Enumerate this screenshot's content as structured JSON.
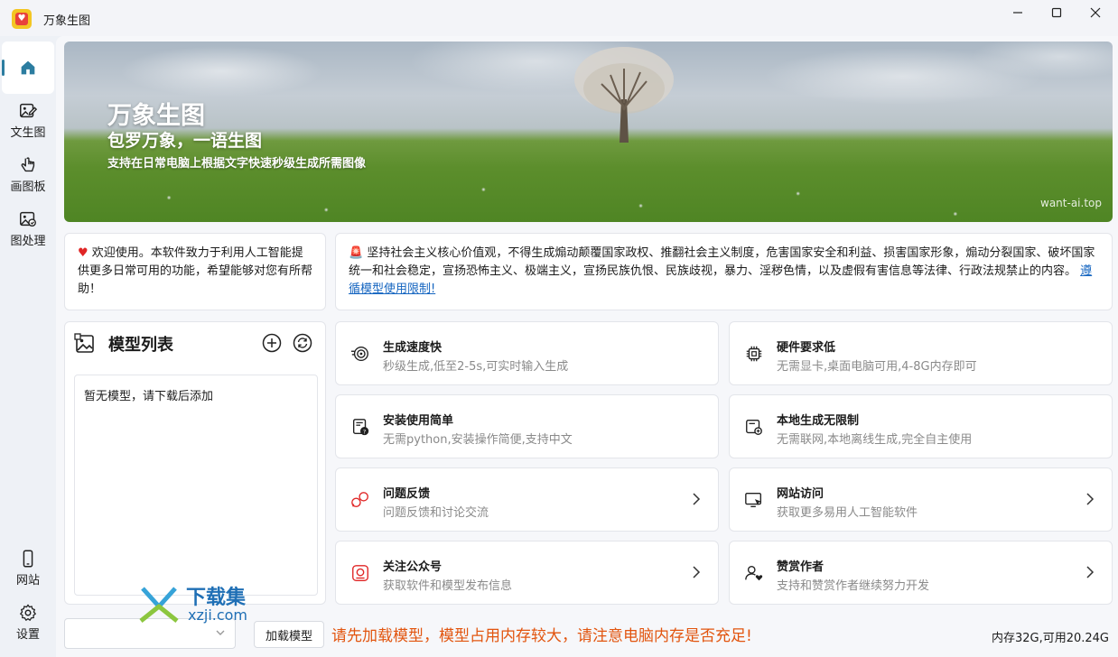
{
  "window": {
    "title": "万象生图",
    "controls": [
      "minimize",
      "maximize",
      "close"
    ]
  },
  "sidebar": {
    "items": [
      {
        "id": "home",
        "label": "",
        "icon": "home-icon",
        "active": true
      },
      {
        "id": "text2img",
        "label": "文生图",
        "icon": "image-edit-icon"
      },
      {
        "id": "canvas",
        "label": "画图板",
        "icon": "hand-draw-icon"
      },
      {
        "id": "imgproc",
        "label": "图处理",
        "icon": "image-process-icon"
      },
      {
        "id": "website",
        "label": "网站",
        "icon": "phone-icon"
      },
      {
        "id": "settings",
        "label": "设置",
        "icon": "gear-icon"
      }
    ]
  },
  "banner": {
    "title": "万象生图",
    "subtitle": "包罗万象，一语生图",
    "description": "支持在日常电脑上根据文字快速秒级生成所需图像",
    "watermark": "want-ai.top"
  },
  "welcome": {
    "text": "欢迎使用。本软件致力于利用人工智能提供更多日常可用的功能，希望能够对您有所帮助！"
  },
  "notice": {
    "text": "坚持社会主义核心价值观，不得生成煽动颠覆国家政权、推翻社会主义制度，危害国家安全和利益、损害国家形象，煽动分裂国家、破坏国家统一和社会稳定，宣扬恐怖主义、极端主义，宣扬民族仇恨、民族歧视，暴力、淫秽色情，以及虚假有害信息等法律、行政法规禁止的内容。",
    "link": "遵循模型使用限制!"
  },
  "models": {
    "title": "模型列表",
    "empty_text": "暂无模型，请下载后添加"
  },
  "features": [
    {
      "title": "生成速度快",
      "desc": "秒级生成,低至2-5s,可实时输入生成",
      "icon": "speed-icon",
      "chevron": false
    },
    {
      "title": "硬件要求低",
      "desc": "无需显卡,桌面电脑可用,4-8G内存即可",
      "icon": "chip-icon",
      "chevron": false
    },
    {
      "title": "安装使用简单",
      "desc": "无需python,安装操作简便,支持中文",
      "icon": "install-icon",
      "chevron": false
    },
    {
      "title": "本地生成无限制",
      "desc": "无需联网,本地离线生成,完全自主使用",
      "icon": "local-device-icon",
      "chevron": false
    },
    {
      "title": "问题反馈",
      "desc": "问题反馈和讨论交流",
      "icon": "chat-bubbles-icon",
      "chevron": true
    },
    {
      "title": "网站访问",
      "desc": "获取更多易用人工智能软件",
      "icon": "monitor-cursor-icon",
      "chevron": true
    },
    {
      "title": "关注公众号",
      "desc": "获取软件和模型发布信息",
      "icon": "wechat-icon",
      "chevron": true
    },
    {
      "title": "赞赏作者",
      "desc": "支持和赞赏作者继续努力开发",
      "icon": "user-heart-icon",
      "chevron": true
    }
  ],
  "bottom": {
    "model_select_value": "",
    "load_button": "加载模型",
    "warning": "请先加载模型，模型占用内存较大，请注意电脑内存是否充足!",
    "memory": "内存32G,可用20.24G"
  },
  "overlay": {
    "logo_text": "下载集",
    "logo_url": "xzji.com"
  },
  "colors": {
    "accent": "#2c7da0",
    "warning": "#e2550f",
    "link": "#1565c0",
    "heart": "#e02626"
  }
}
